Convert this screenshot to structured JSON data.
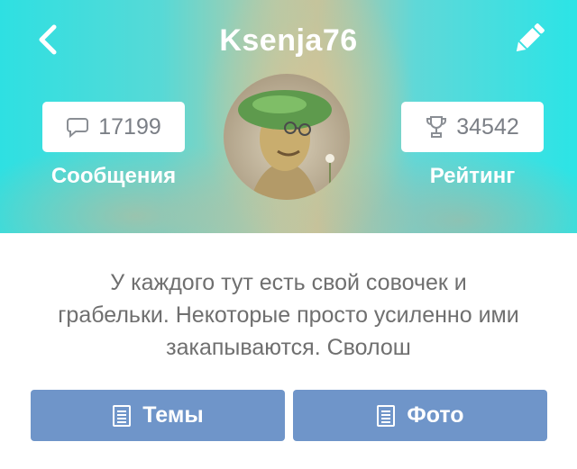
{
  "profile": {
    "username": "Ksenja76",
    "messages_count": "17199",
    "messages_label": "Сообщения",
    "rating_value": "34542",
    "rating_label": "Рейтинг",
    "bio_lines": [
      "У каждого тут есть свой совочек и",
      "грабельки. Некоторые просто усиленно ими",
      "закапываются. Сволош"
    ]
  },
  "actions": {
    "topics_label": "Темы",
    "photo_label": "Фото"
  },
  "icons": {
    "back": "chevron-left-icon",
    "edit": "pencil-icon",
    "messages": "speech-bubble-icon",
    "rating": "trophy-icon",
    "document": "document-icon"
  },
  "colors": {
    "header_accent": "#2ee0e2",
    "button": "#6f95c9",
    "text_muted": "#6f6f6f"
  }
}
